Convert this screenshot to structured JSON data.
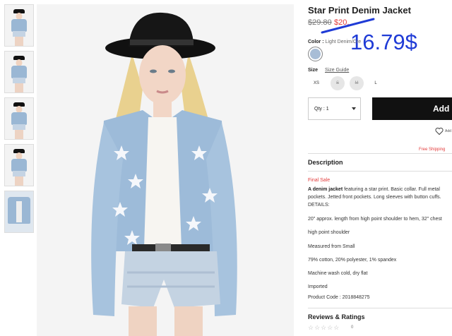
{
  "product": {
    "title": "Star Print Denim Jacket",
    "old_price": "$29.80",
    "sale_price": "$20.",
    "handwritten_price": "16.79$",
    "color_label": "Color :",
    "color_value": "Light Denim/Cre",
    "swatch_color": "#a8bdd6"
  },
  "size": {
    "label": "Size",
    "guide": "Size Guide",
    "options": [
      "XS",
      "S",
      "M",
      "L"
    ]
  },
  "cart": {
    "qty": "Qty : 1",
    "add_label": "Add",
    "wishlist": "Add",
    "free_shipping": "Free Shipping"
  },
  "description": {
    "heading": "Description",
    "final_sale": "Final Sale",
    "lead": "A denim jacket",
    "body": " featuring a star print. Basic collar. Full metal pockets. Jetted front pockets. Long sleeves with button cuffs.",
    "details_label": "DETAILS:",
    "details": [
      "20\" approx. length from high point shoulder to hem, 32\" chest",
      "high point shoulder",
      "Measured from Small",
      "79% cotton, 20% polyester, 1% spandex",
      "Machine wash cold, dry flat",
      "Imported",
      "Product Code : 2018848275"
    ]
  },
  "reviews": {
    "heading": "Reviews & Ratings",
    "stars": "☆☆☆☆☆",
    "count": "0"
  },
  "colors": {
    "accent_red": "#e23b3b",
    "handwriting_blue": "#1f3bd6",
    "button_black": "#111111"
  }
}
